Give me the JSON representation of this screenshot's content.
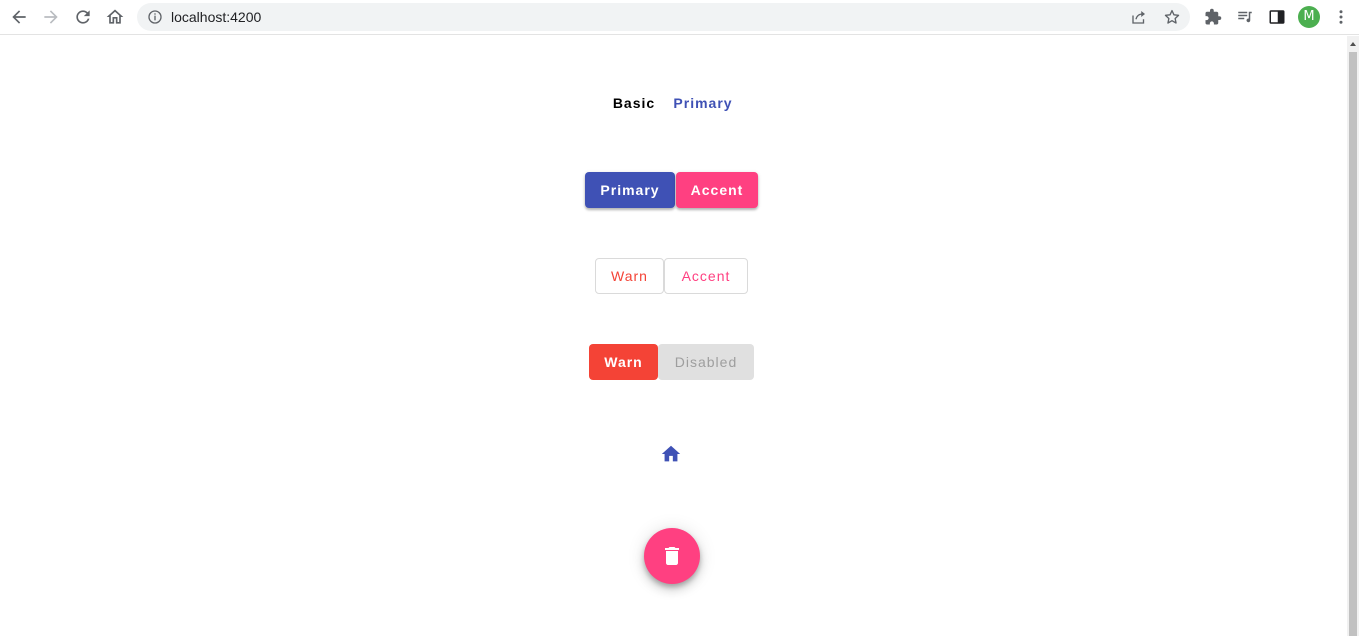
{
  "browser": {
    "url": "localhost:4200",
    "avatar_letter": "M",
    "avatar_color": "#4caf50"
  },
  "colors": {
    "primary": "#3f51b5",
    "accent": "#ff4081",
    "warn": "#f44336",
    "disabled_bg": "#e0e0e0",
    "disabled_text": "#9e9e9e",
    "text_basic": "#000000"
  },
  "rows": {
    "text_buttons": {
      "basic_label": "Basic",
      "primary_label": "Primary"
    },
    "raised_buttons": {
      "primary_label": "Primary",
      "accent_label": "Accent"
    },
    "stroked_buttons": {
      "warn_label": "Warn",
      "accent_label": "Accent"
    },
    "flat_buttons": {
      "warn_label": "Warn",
      "disabled_label": "Disabled"
    },
    "icon_button": {
      "icon": "home-icon"
    },
    "fab_button": {
      "icon": "delete-icon"
    }
  }
}
